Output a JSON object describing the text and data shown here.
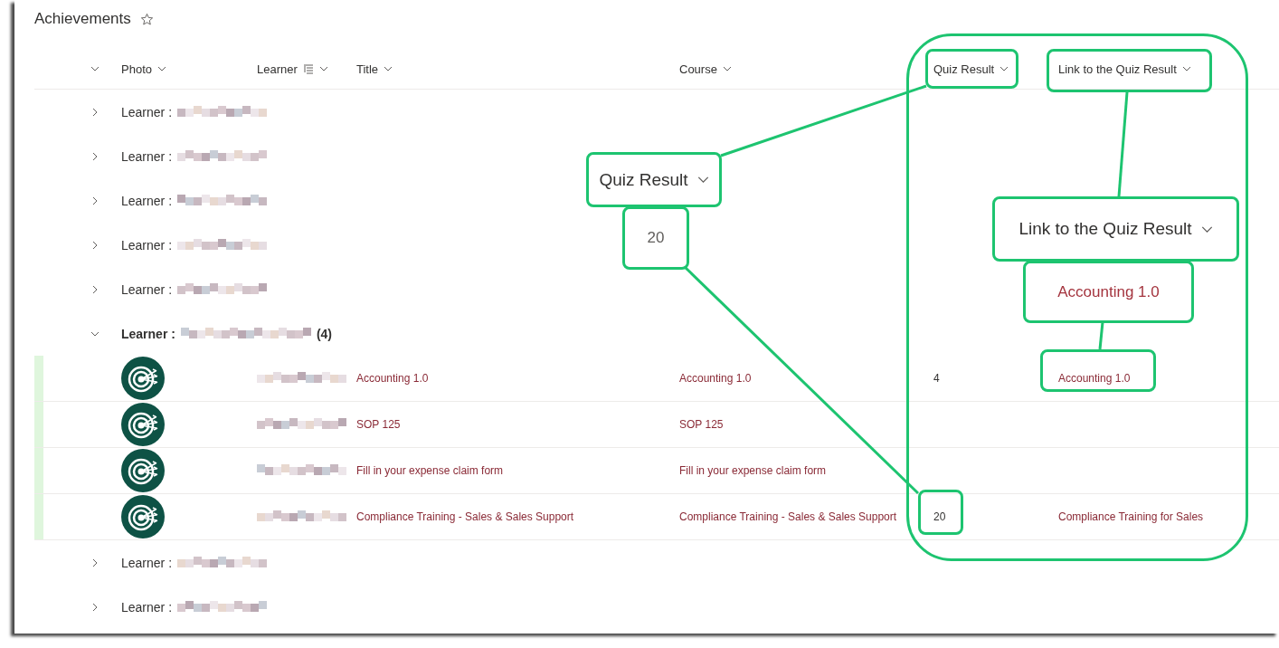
{
  "list": {
    "title": "Achievements",
    "favorite": false
  },
  "columns": [
    {
      "label": "Photo",
      "grouped": false
    },
    {
      "label": "Learner",
      "grouped": true
    },
    {
      "label": "Title",
      "grouped": false
    },
    {
      "label": "Course",
      "grouped": false
    },
    {
      "label": "Quiz Result",
      "grouped": false
    },
    {
      "label": "Link to the Quiz Result",
      "grouped": false
    }
  ],
  "groups": [
    {
      "label": "Learner :",
      "expanded": false
    },
    {
      "label": "Learner :",
      "expanded": false
    },
    {
      "label": "Learner :",
      "expanded": false
    },
    {
      "label": "Learner :",
      "expanded": false
    },
    {
      "label": "Learner :",
      "expanded": false
    },
    {
      "label": "Learner :",
      "expanded": true,
      "count": "(4)",
      "items": [
        {
          "title": "Accounting 1.0",
          "course": "Accounting 1.0",
          "quiz_result": "4",
          "quiz_link": "Accounting 1.0"
        },
        {
          "title": "SOP 125",
          "course": "SOP 125"
        },
        {
          "title": "Fill in your expense claim form",
          "course": "Fill in your expense claim form"
        },
        {
          "title": "Compliance Training - Sales & Sales Support",
          "course": "Compliance Training - Sales & Sales Support",
          "quiz_result": "20",
          "quiz_link": "Compliance Training for Sales"
        }
      ]
    },
    {
      "label": "Learner :",
      "expanded": false
    },
    {
      "label": "Learner :",
      "expanded": false
    }
  ],
  "callouts": {
    "quiz_header": "Quiz Result",
    "quiz_value": "20",
    "link_header": "Link to the Quiz Result",
    "link_value": "Accounting 1.0"
  }
}
